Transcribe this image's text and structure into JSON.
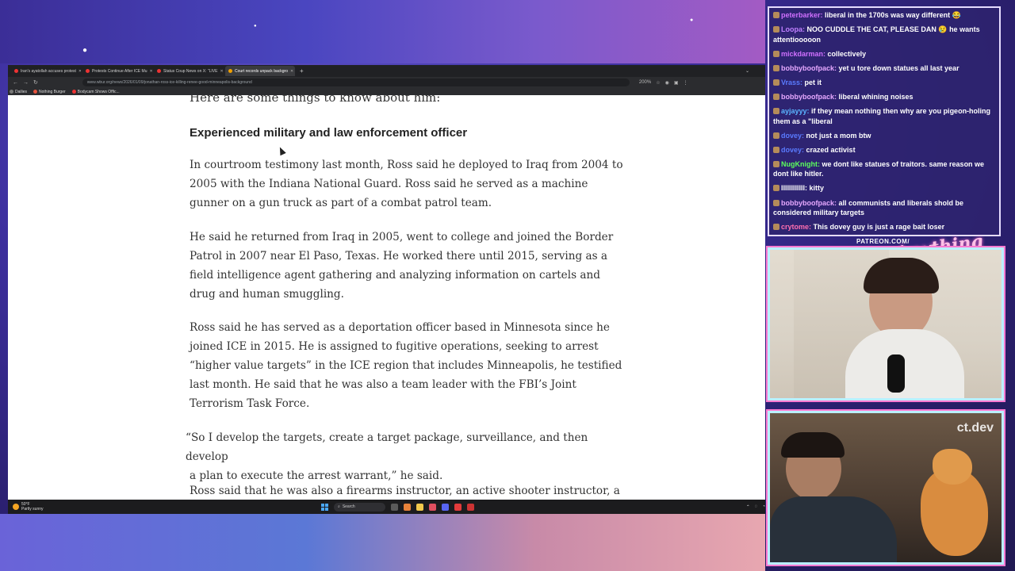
{
  "browser": {
    "tabs": [
      {
        "label": "Iran's ayatollah accuses protest",
        "active": false
      },
      {
        "label": "Protests Continue After ICE Mu",
        "active": false
      },
      {
        "label": "Status Coup News on X: \"LIVE",
        "active": false
      },
      {
        "label": "Court records unpack backgro",
        "active": true
      }
    ],
    "url": "www.wbur.org/news/2026/01/09/jonathan-ross-ice-killing-renee-good-minneapolis-background",
    "zoom": "200%",
    "bookmarks": [
      "Dailies",
      "Nothing Burger",
      "Bodycam Shows Offic..."
    ]
  },
  "article": {
    "intro": "Here are some things to know about him:",
    "heading": "Experienced military and law enforcement officer",
    "paragraphs": [
      [
        "In courtroom testimony last month, Ross said he deployed to Iraq from 2004 to",
        "2005 with the Indiana National Guard. Ross said he served as a machine",
        "gunner on a gun truck as part of a combat patrol team."
      ],
      [
        "He said he returned from Iraq in 2005, went to college and joined the Border",
        "Patrol in 2007 near El Paso, Texas. He worked there until 2015, serving as a",
        "field intelligence agent gathering and analyzing information on cartels and",
        "drug and human smuggling."
      ],
      [
        "Ross said he has served as a deportation officer based in Minnesota since he",
        "joined ICE in 2015. He is assigned to fugitive operations, seeking to arrest",
        "“higher value targets” in the ICE region that includes Minneapolis, he testified",
        "last month. He said that he was also a team leader with the FBI’s Joint",
        "Terrorism Task Force."
      ],
      [
        "“So I develop the targets, create a target package, surveillance, and then develop",
        "a plan to execute the arrest warrant,” he said."
      ],
      [
        "Ross said that he was also a firearms instructor, an active shooter instructor, a"
      ]
    ]
  },
  "taskbar": {
    "weather_temp": "50°F",
    "weather_desc": "Partly sunny",
    "search_label": "Search"
  },
  "chat": {
    "messages": [
      {
        "user": "peterbarker:",
        "text": "liberal in the 1700s was way different 😂",
        "color": "#d070ff"
      },
      {
        "user": "Loopa:",
        "text": "NOO CUDDLE THE CAT, PLEASE DAN 😢 he wants attentiooooon",
        "color": "#c080ff"
      },
      {
        "user": "mickdarman:",
        "text": "collectively",
        "color": "#d070ff"
      },
      {
        "user": "bobbyboofpack:",
        "text": "yet u tore down statues all last year",
        "color": "#e6a8ff"
      },
      {
        "user": "Vrass:",
        "text": "pet it",
        "color": "#5a7bff"
      },
      {
        "user": "bobbyboofpack:",
        "text": "liberal whining noises",
        "color": "#e6a8ff"
      },
      {
        "user": "ayjayyy:",
        "text": "if they mean nothing then why are you pigeon-holing them as a \"liberal",
        "color": "#5ab4ff"
      },
      {
        "user": "dovey:",
        "text": "not just a mom btw",
        "color": "#5a7bff"
      },
      {
        "user": "dovey:",
        "text": "crazed activist",
        "color": "#5a7bff"
      },
      {
        "user": "NugKnight:",
        "text": "we dont like statues of traitors. same reason we dont like hitler.",
        "color": "#5cff5c"
      },
      {
        "user": "IIIIIIIIIIII:",
        "text": "kitty",
        "color": "#ffffff"
      },
      {
        "user": "bobbyboofpack:",
        "text": "all communists and liberals shold be considered military targets",
        "color": "#e6a8ff"
      },
      {
        "user": "crytome:",
        "text": "This dovey guy is just a rage bait loser",
        "color": "#ff6fb0"
      }
    ]
  },
  "overlay": {
    "patreon": "PATREON.COM/",
    "script_logo": "Anything Else?",
    "cam_watermark": "ct.dev"
  }
}
